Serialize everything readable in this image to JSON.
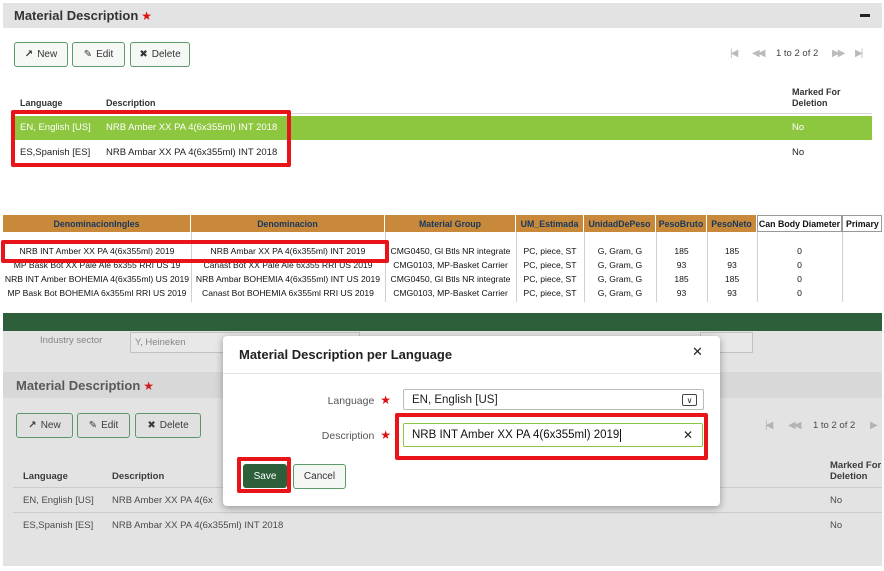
{
  "top_panel": {
    "title": "Material Description",
    "required_mark": "★",
    "collapse_icon": "minus-icon",
    "buttons": {
      "new": "New",
      "edit": "Edit",
      "delete": "Delete"
    },
    "pager": {
      "text": "1 to 2 of 2"
    },
    "columns": {
      "language": "Language",
      "description": "Description",
      "marked": [
        "Marked For",
        "Deletion"
      ]
    },
    "rows": [
      {
        "language": "EN, English [US]",
        "description": "NRB Amber XX PA 4(6x355ml) INT 2018",
        "marked": "No"
      },
      {
        "language": "ES,Spanish [ES]",
        "description": "NRB Ambar XX PA 4(6x355ml) INT 2018",
        "marked": "No"
      }
    ],
    "accent_color": "#8dc63f"
  },
  "spreadsheet": {
    "headers": [
      "DenominacionIngles",
      "Denominacion",
      "Material Group",
      "UM_Estimada",
      "UnidadDePeso",
      "PesoBruto",
      "PesoNeto",
      "Can Body Diameter",
      "Primary P"
    ],
    "rows": [
      [
        "NRB INT Amber XX PA 4(6x355ml) 2019",
        "NRB Ambar XX PA 4(6x355ml) INT 2019",
        "CMG0450, Gl Btls NR integrate",
        "PC, piece, ST",
        "G, Gram, G",
        "185",
        "185",
        "0",
        ""
      ],
      [
        "MP Bask Bot XX Pale Ale 6x355 RRI US 19",
        "Canast Bot XX Pale Ale 6x355 RRI US 2019",
        "CMG0103, MP-Basket Carrier",
        "PC, piece, ST",
        "G, Gram, G",
        "93",
        "93",
        "0",
        ""
      ],
      [
        "NRB INT Amber BOHEMIA 4(6x355ml) US 2019",
        "NRB Ambar BOHEMIA 4(6x355ml) INT US 2019",
        "CMG0450, Gl Btls NR integrate",
        "PC, piece, ST",
        "G, Gram, G",
        "185",
        "185",
        "0",
        ""
      ],
      [
        "MP Bask Bot BOHEMIA 6x355ml RRI US 2019",
        "Canast Bot BOHEMIA 6x355ml RRI US 2019",
        "CMG0103, MP-Basket Carrier",
        "PC, piece, ST",
        "G, Gram, G",
        "93",
        "93",
        "0",
        ""
      ]
    ],
    "header_color": "#c8893a"
  },
  "bottom_panel": {
    "industry_label": "Industry sector",
    "industry_value": "Y, Heineken",
    "title": "Material Description",
    "required_mark": "★",
    "buttons": {
      "new": "New",
      "edit": "Edit",
      "delete": "Delete"
    },
    "pager": {
      "text": "1 to 2 of 2"
    },
    "columns": {
      "language": "Language",
      "description": "Description",
      "marked": [
        "Marked For",
        "Deletion"
      ]
    },
    "rows": [
      {
        "language": "EN, English [US]",
        "description": "NRB Amber XX PA 4(6x",
        "marked": "No"
      },
      {
        "language": "ES,Spanish [ES]",
        "description": "NRB Ambar XX PA 4(6x355ml) INT 2018",
        "marked": "No"
      }
    ]
  },
  "modal": {
    "title": "Material Description per Language",
    "close_icon": "close-icon",
    "language_label": "Language",
    "language_value": "EN, English [US]",
    "description_label": "Description",
    "description_value": "NRB INT Amber XX PA 4(6x355ml) 2019",
    "required_mark": "★",
    "save_label": "Save",
    "cancel_label": "Cancel",
    "save_color": "#2d5f3a"
  },
  "highlight_color": "#e8141a"
}
